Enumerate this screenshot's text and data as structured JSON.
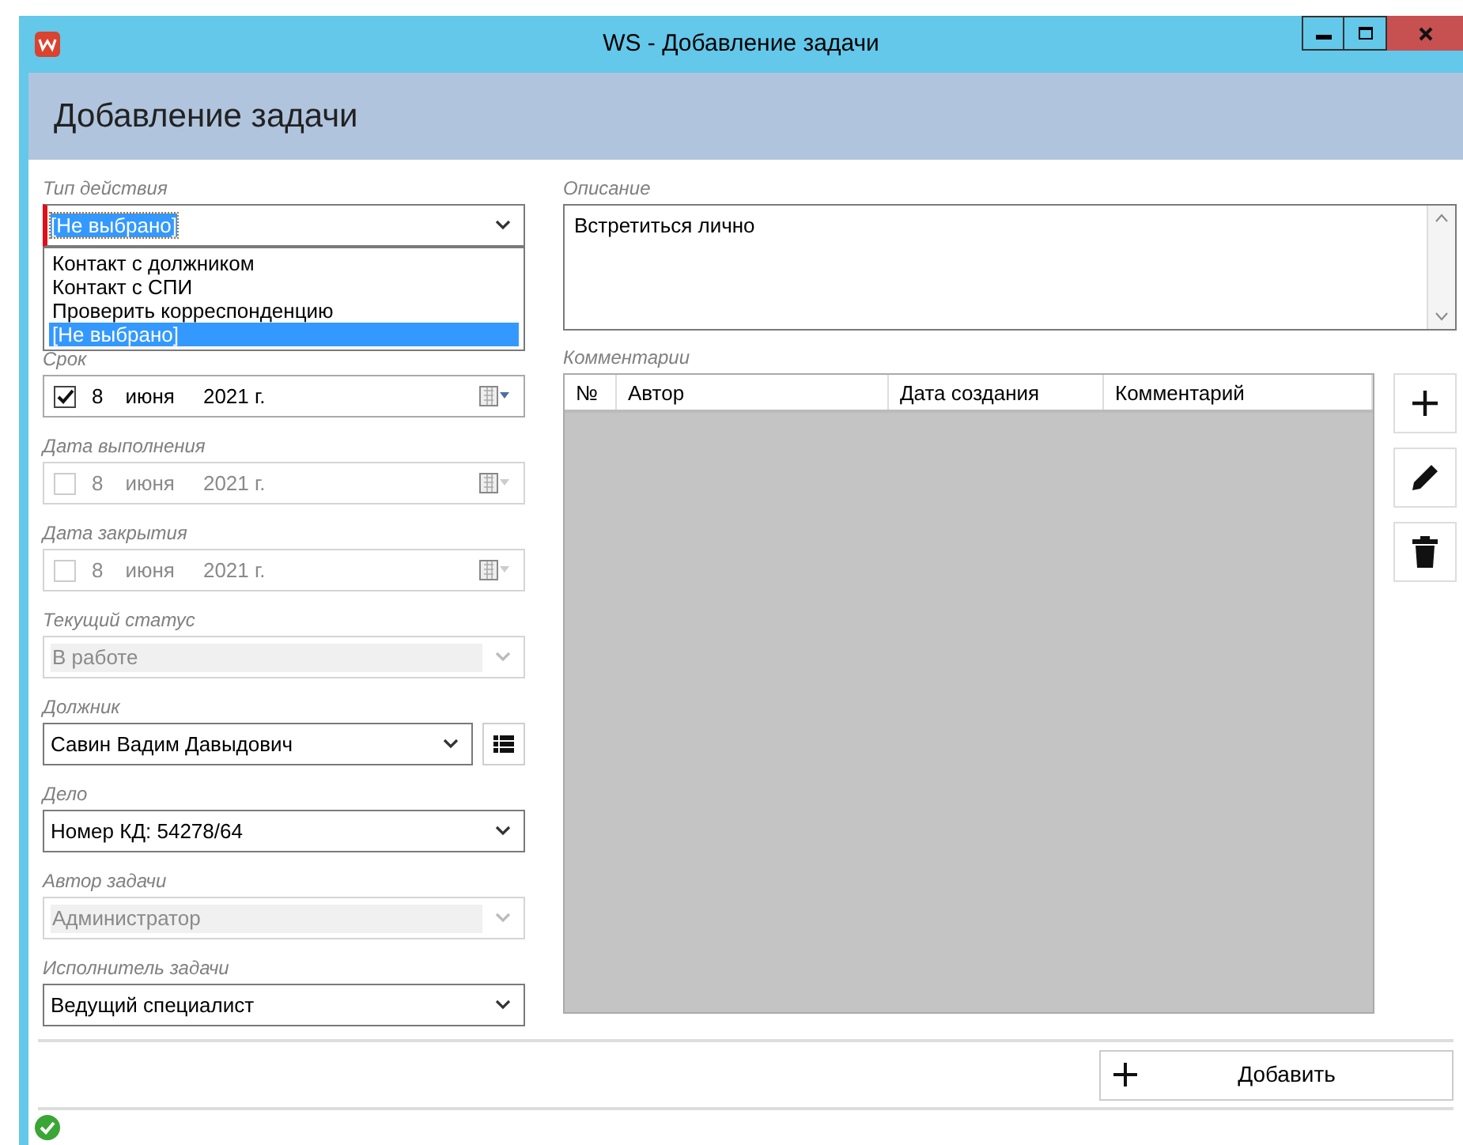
{
  "window": {
    "title": "WS - Добавление задачи"
  },
  "header": "Добавление задачи",
  "fields": [
    {
      "label": "Тип действия",
      "kind": "combo",
      "value": "[Не выбрано]",
      "disabled": false,
      "invalid": true,
      "focused": true,
      "options": [
        {
          "label": "Контакт с должником",
          "selected": false
        },
        {
          "label": "Контакт с СПИ",
          "selected": false
        },
        {
          "label": "Проверить корреспонденцию",
          "selected": false
        },
        {
          "label": "[Не выбрано]",
          "selected": true
        }
      ]
    },
    {
      "label": "Срок",
      "kind": "date",
      "checked": true,
      "disabled": false,
      "day": "8",
      "month": "июня",
      "year": "2021 г."
    },
    {
      "label": "Дата выполнения",
      "kind": "date",
      "checked": false,
      "disabled": true,
      "day": "8",
      "month": "июня",
      "year": "2021 г."
    },
    {
      "label": "Дата закрытия",
      "kind": "date",
      "checked": false,
      "disabled": true,
      "day": "8",
      "month": "июня",
      "year": "2021 г."
    },
    {
      "label": "Текущий статус",
      "kind": "combo",
      "value": "В работе",
      "disabled": true,
      "invalid": false,
      "focused": false
    },
    {
      "label": "Должник",
      "kind": "combo",
      "value": "Савин Вадим Давыдович",
      "disabled": false,
      "invalid": false,
      "focused": false,
      "list_button": true
    },
    {
      "label": "Дело",
      "kind": "combo",
      "value": "Номер КД: 54278/64",
      "disabled": false,
      "invalid": false,
      "focused": false
    },
    {
      "label": "Автор задачи",
      "kind": "combo",
      "value": "Администратор",
      "disabled": true,
      "invalid": false,
      "focused": false
    },
    {
      "label": "Исполнитель задачи",
      "kind": "combo",
      "value": "Ведущий специалист",
      "disabled": false,
      "invalid": false,
      "focused": false
    }
  ],
  "description": {
    "label": "Описание",
    "value": "Встретиться лично"
  },
  "comments": {
    "label": "Комментарии",
    "columns": [
      "№",
      "Автор",
      "Дата создания",
      "Комментарий"
    ],
    "actions": [
      {
        "kind": "add"
      },
      {
        "kind": "edit"
      },
      {
        "kind": "delete"
      }
    ]
  },
  "submit_button": "Добавить",
  "status": {
    "kind": "ok"
  }
}
